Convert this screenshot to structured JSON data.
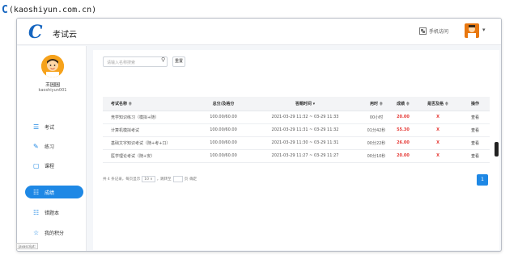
{
  "watermark": {
    "logo_glyph": "C",
    "text": "(kaoshiyun.com.cn)"
  },
  "header": {
    "logo_glyph": "C",
    "app_title": "考试云",
    "mobile_visit": "手机访问",
    "avatar_icon": "user-avatar-icon",
    "caret": "▾"
  },
  "user": {
    "name": "王园园",
    "id": "kaoshiyun001"
  },
  "nav": [
    {
      "icon": "☰",
      "label": "考试",
      "active": false
    },
    {
      "icon": "✎",
      "label": "练习",
      "active": false
    },
    {
      "icon": "▢",
      "label": "课程",
      "active": false
    },
    {
      "icon": "☷",
      "label": "成绩",
      "active": true
    },
    {
      "icon": "☷",
      "label": "错题本",
      "active": false
    },
    {
      "icon": "☆",
      "label": "我的积分",
      "active": false
    }
  ],
  "search": {
    "placeholder": "请输入名称搜索",
    "reset_label": "重置"
  },
  "table": {
    "headers": [
      "考试名称 ≑",
      "总分/及格分",
      "答题时间 ▾",
      "用时 ≑",
      "成绩 ≑",
      "是否及格 ≑",
      "操作"
    ],
    "rows": [
      {
        "name": "竞学知识练习（模拟+随）",
        "score_pass": "100.00/60.00",
        "time": "2021-03-29 11:32 ~ 03-29 11:33",
        "duration": "00小时",
        "grade": "20.00",
        "passed": "X",
        "action": "查看"
      },
      {
        "name": "计算机模拟考试",
        "score_pass": "100.00/60.00",
        "time": "2021-03-29 11:31 ~ 03-29 11:32",
        "duration": "01分42秒",
        "grade": "55.30",
        "passed": "X",
        "action": "查看"
      },
      {
        "name": "基础文字知识考试（随+考+口）",
        "score_pass": "100.00/60.00",
        "time": "2021-03-29 11:30 ~ 03-29 11:31",
        "duration": "00分22秒",
        "grade": "26.00",
        "passed": "X",
        "action": "查看"
      },
      {
        "name": "医学理论考试（随+安）",
        "score_pass": "100.00/60.00",
        "time": "2021-03-29 11:27 ~ 03-29 11:27",
        "duration": "00分10秒",
        "grade": "20.00",
        "passed": "X",
        "action": "查看"
      }
    ]
  },
  "pager": {
    "summary": "共 4 条记录，每页显示",
    "page_size": "10 ∨",
    "jump_label": "，跳转至",
    "page_suffix": "页",
    "confirm": "确定",
    "current_page": "1"
  },
  "statusbar": {
    "text": "javascript:"
  },
  "colors": {
    "accent": "#1e88e5",
    "fail": "#e53935"
  }
}
